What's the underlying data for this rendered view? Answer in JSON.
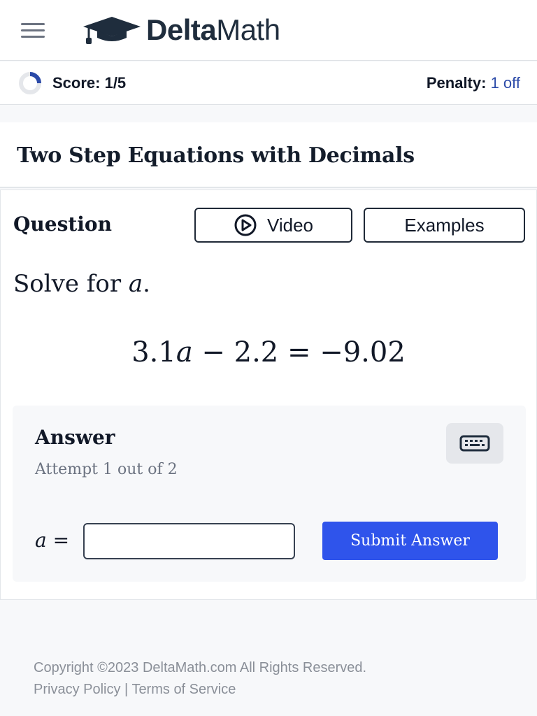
{
  "header": {
    "menu_icon": "hamburger-menu-icon",
    "logo_icon": "graduation-cap-icon",
    "brand_bold": "Delta",
    "brand_regular": "Math"
  },
  "scorebar": {
    "progress_icon": "progress-ring-icon",
    "score_label": "Score: 1/5",
    "penalty_label": "Penalty:",
    "penalty_value": "1 off"
  },
  "assignment": {
    "title": "Two Step Equations with Decimals"
  },
  "question": {
    "heading": "Question",
    "video_label": "Video",
    "video_icon": "play-circle-icon",
    "examples_label": "Examples",
    "prompt_text": "Solve for ",
    "prompt_var": "a",
    "prompt_end": ".",
    "equation_parts": [
      "3.1",
      "a",
      " − 2.2 = −9.02"
    ]
  },
  "answer": {
    "heading": "Answer",
    "attempt_text": "Attempt 1 out of 2",
    "keyboard_icon": "keyboard-icon",
    "variable": "a",
    "equals": " =",
    "input_value": "",
    "submit_label": "Submit Answer"
  },
  "footer": {
    "copyright": "Copyright ©2023 DeltaMath.com All Rights Reserved.",
    "privacy_label": "Privacy Policy",
    "separator": " | ",
    "terms_label": "Terms of Service"
  },
  "colors": {
    "accent_blue": "#2f54eb",
    "penalty_value": "#2b4aa8",
    "muted_text": "#6b7280",
    "panel_bg": "#f7f8fa"
  }
}
